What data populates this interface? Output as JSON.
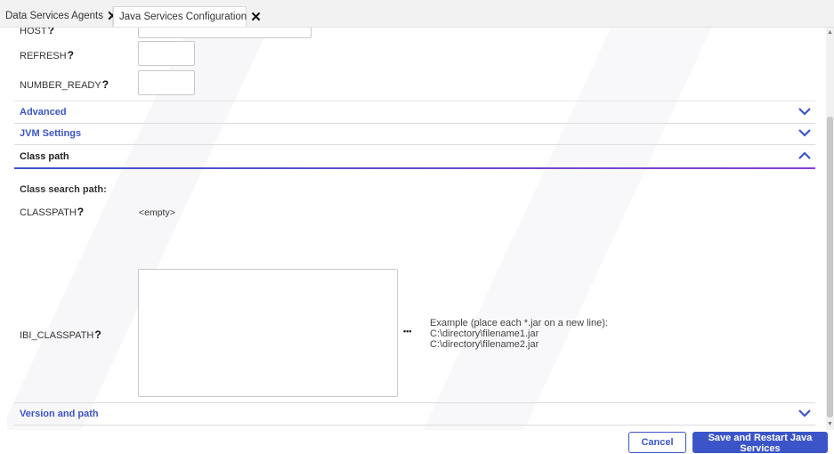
{
  "tabs": [
    {
      "label": "Data Services Agents",
      "close": "✕"
    },
    {
      "label": "Java Services Configuration",
      "close": "✕"
    }
  ],
  "fields": {
    "host_label": "HOST",
    "refresh_label": "REFRESH",
    "refresh_value": "",
    "number_ready_label": "NUMBER_READY",
    "number_ready_value": "",
    "help_mark": "?"
  },
  "sections": {
    "advanced": "Advanced",
    "jvm_settings": "JVM Settings",
    "class_path": "Class path",
    "version_and_path": "Version and path"
  },
  "class_path": {
    "search_path_label": "Class search path:",
    "classpath_label": "CLASSPATH",
    "classpath_value": "<empty>",
    "ibi_classpath_label": "IBI_CLASSPATH",
    "ibi_classpath_value": "",
    "ellipsis": "•••",
    "example_line1": "Example (place each *.jar on a new line):",
    "example_line2": "C:\\directory\\filename1.jar",
    "example_line3": "C:\\directory\\filename2.jar"
  },
  "buttons": {
    "cancel": "Cancel",
    "save_restart": "Save and Restart Java Services"
  },
  "colors": {
    "accent": "#3b55c9",
    "accent_gradient_end": "#8a3fd1"
  },
  "icons": {
    "tab_close": "close-icon",
    "section_collapsed": "chevron-down-icon",
    "section_expanded": "chevron-up-icon"
  }
}
